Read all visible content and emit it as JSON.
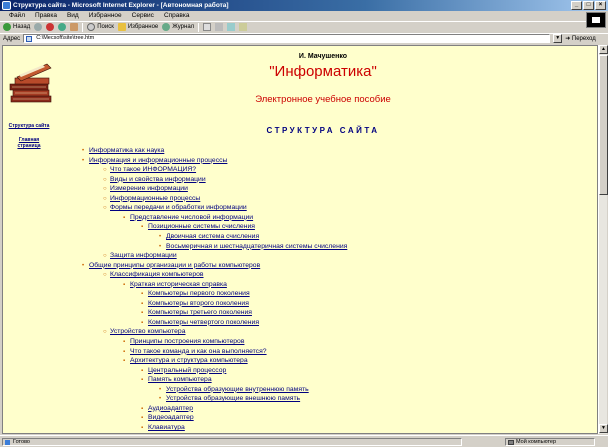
{
  "window": {
    "title": "Структура сайта - Microsoft Internet Explorer - [Автономная работа]"
  },
  "menu": [
    "Файл",
    "Правка",
    "Вид",
    "Избранное",
    "Сервис",
    "Справка"
  ],
  "toolbar": {
    "back": "Назад",
    "search": "Поиск",
    "favorites": "Избранное",
    "journal": "Журнал"
  },
  "address": {
    "label": "Адрес",
    "value": "C:\\Mecsoft\\site\\tree.htm",
    "go": "Переход"
  },
  "sidebar": {
    "structure_link": "Структура сайта",
    "home_link": "Главная страница"
  },
  "page": {
    "author": "И. Мачушенко",
    "title": "\"Информатика\"",
    "subtitle": "Электронное учебное пособие",
    "heading": "СТРУКТУРА САЙТА"
  },
  "tree": [
    {
      "label": "Информатика как наука",
      "level": 0
    },
    {
      "label": "Информация и информационные процессы",
      "level": 0
    },
    {
      "label": "Что такое ИНФОРМАЦИЯ?",
      "level": 1
    },
    {
      "label": "Виды и свойства информации",
      "level": 1
    },
    {
      "label": "Измерение информации",
      "level": 1
    },
    {
      "label": "Информационные процессы",
      "level": 1
    },
    {
      "label": "Формы передачи и обработки информации",
      "level": 1
    },
    {
      "label": "Представление числовой информации",
      "level": 2
    },
    {
      "label": "Позиционные системы счисления",
      "level": 3
    },
    {
      "label": "Двоичная система счисления",
      "level": 4
    },
    {
      "label": "Восьмеричная и шестнадцатеричная системы счисления",
      "level": 4
    },
    {
      "label": "Защита информации",
      "level": 1
    },
    {
      "label": "Общие принципы организации и работы компьютеров",
      "level": 0
    },
    {
      "label": "Классификация компьютеров",
      "level": 1
    },
    {
      "label": "Краткая историческая справка",
      "level": 2
    },
    {
      "label": "Компьютеры первого поколения",
      "level": 3
    },
    {
      "label": "Компьютеры второго поколения",
      "level": 3
    },
    {
      "label": "Компьютеры третьего поколения",
      "level": 3
    },
    {
      "label": "Компьютеры четвертого поколения",
      "level": 3
    },
    {
      "label": "Устройство компьютера",
      "level": 1
    },
    {
      "label": "Принципы построения компьютеров",
      "level": 2
    },
    {
      "label": "Что такое команда и как она выполняется?",
      "level": 2
    },
    {
      "label": "Архитектура и структура компьютера",
      "level": 2
    },
    {
      "label": "Центральный процессор",
      "level": 3
    },
    {
      "label": "Память компьютера",
      "level": 3
    },
    {
      "label": "Устройства образующие внутреннюю память",
      "level": 4
    },
    {
      "label": "Устройства образующие внешнюю память",
      "level": 4
    },
    {
      "label": "Аудиоадаптер",
      "level": 3
    },
    {
      "label": "Видеоадаптер",
      "level": 3
    },
    {
      "label": "Клавиатура",
      "level": 3
    }
  ],
  "status": {
    "text": "Готово",
    "zone": "Мой компьютер"
  }
}
